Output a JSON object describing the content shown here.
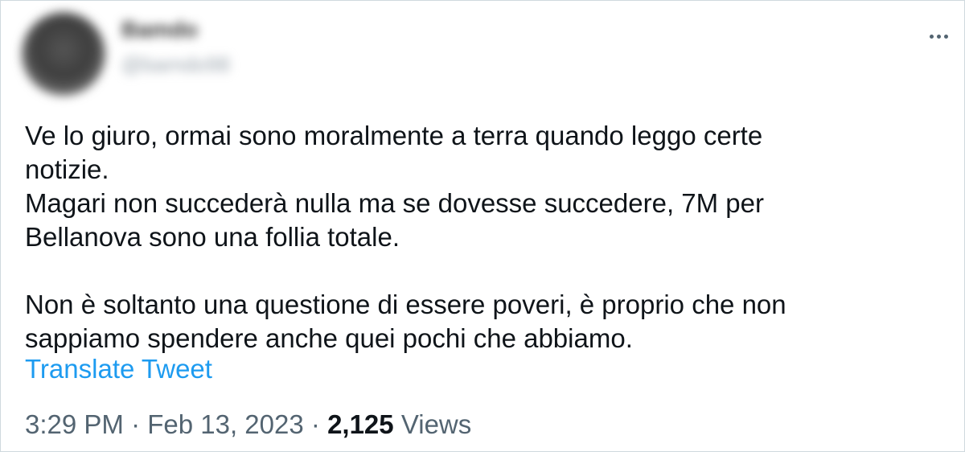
{
  "author": {
    "display_name": "Bamdo",
    "handle": "@bamdo98"
  },
  "more_icon": "more-horizontal-icon",
  "tweet": {
    "lines_para1": [
      "Ve lo giuro, ormai sono moralmente a terra quando leggo certe",
      "notizie.",
      "Magari non succederà nulla ma se dovesse succedere, 7M per",
      "Bellanova sono una follia totale."
    ],
    "lines_para2": [
      "Non è soltanto una questione di essere poveri, è proprio che non",
      "sappiamo spendere anche quei pochi che abbiamo."
    ]
  },
  "translate_label": "Translate Tweet",
  "meta": {
    "time": "3:29 PM",
    "separator": " · ",
    "date": "Feb 13, 2023",
    "views_count": "2,125",
    "views_label": "Views"
  },
  "colors": {
    "link": "#1d9bf0",
    "secondary_text": "#536471",
    "primary_text": "#0f1419"
  }
}
